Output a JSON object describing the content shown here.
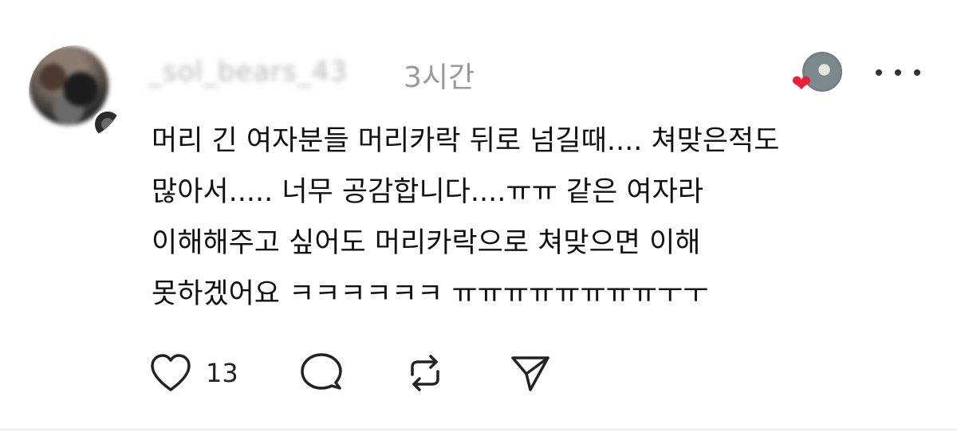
{
  "post": {
    "author": {
      "username": "_sol_bears_43",
      "timestamp": "3시간"
    },
    "body_lines": [
      "머리 긴 여자분들 머리카락 뒤로 넘길때.... 쳐맞은적도",
      "많아서..... 너무 공감합니다....ㅠㅠ 같은 여자라",
      "이해해주고 싶어도 머리카락으로 쳐맞으면 이해",
      "못하겠어요 ㅋㅋㅋㅋㅋㅋ ㅠㅠㅠㅠㅠㅠㅠㅠㅜㅜ"
    ],
    "actions": {
      "like_count": "13"
    },
    "icons": {
      "like": "heart-outline-icon",
      "reply": "comment-bubble-icon",
      "repost": "repost-icon",
      "share": "send-icon",
      "more": "more-horizontal-icon",
      "liked_by": "heart-filled-icon"
    },
    "colors": {
      "liked_heart": "#ee1d3c",
      "timestamp": "#9a9a9a",
      "text": "#111111"
    }
  }
}
